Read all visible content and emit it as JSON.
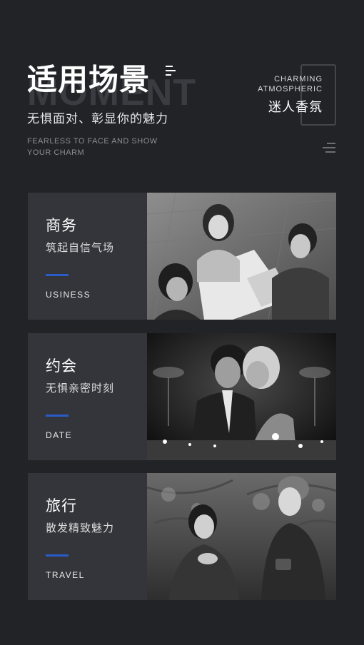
{
  "header": {
    "bg_word": "MOMENT",
    "title": "适用场景",
    "subtitle": "无惧面对、彰显你的魅力",
    "en_subtitle": "FEARLESS TO FACE AND SHOW YOUR CHARM",
    "right_en_line1": "CHARMING",
    "right_en_line2": "ATMOSPHERIC",
    "right_cn": "迷人香氛"
  },
  "colors": {
    "background": "#222327",
    "card": "#34353b",
    "accent": "#2a5cc9"
  },
  "scenes": [
    {
      "label": "商务",
      "desc": "筑起自信气场",
      "en": "USINESS",
      "photo": "business-meeting-photo"
    },
    {
      "label": "约会",
      "desc": "无惧亲密时刻",
      "en": "DATE",
      "photo": "romantic-dinner-photo"
    },
    {
      "label": "旅行",
      "desc": "散发精致魅力",
      "en": "TRAVEL",
      "photo": "travel-friends-photo"
    }
  ]
}
